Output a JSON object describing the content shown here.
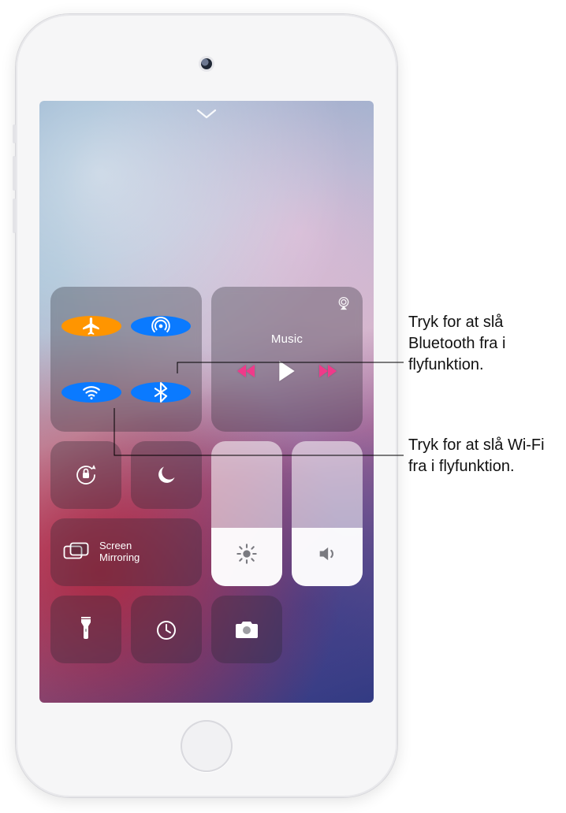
{
  "connectivity": {
    "airplane": {
      "state": "on",
      "color": "#ff9500"
    },
    "airdrop": {
      "state": "on",
      "color": "#0a7aff"
    },
    "wifi": {
      "state": "on",
      "color": "#0a7aff"
    },
    "bluetooth": {
      "state": "on",
      "color": "#0a7aff"
    }
  },
  "media": {
    "source_label": "Music",
    "state": "paused"
  },
  "screen_mirroring": {
    "title_line1": "Screen",
    "title_line2": "Mirroring"
  },
  "sliders": {
    "brightness_pct": 40,
    "volume_pct": 40
  },
  "callouts": {
    "bluetooth": "Tryk for at slå Bluetooth fra i flyfunktion.",
    "wifi": "Tryk for at slå Wi-Fi fra i flyfunktion."
  }
}
